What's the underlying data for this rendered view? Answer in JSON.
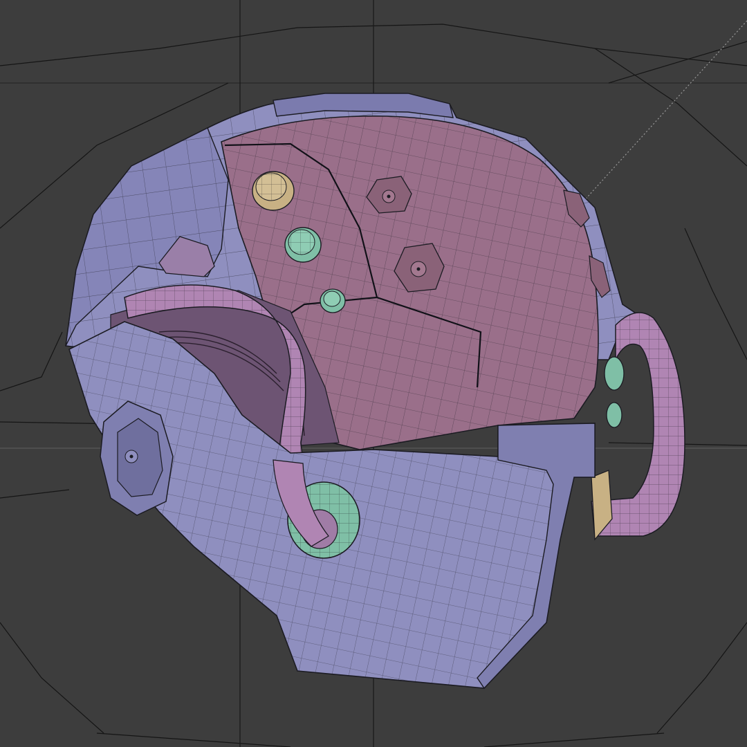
{
  "viewport": {
    "kind": "3d-viewport",
    "background_color": "#3d3d3d",
    "grid_color": "#151515",
    "axis_color": "#1a1a1a"
  },
  "model": {
    "name": "helmet",
    "shell_color": "#8f8fbf",
    "shell_dark_color": "#6f6f9e",
    "dome_color": "#9a6f8a",
    "hose_color": "#b085b3",
    "port_green_color": "#7fbfa6",
    "port_tan_color": "#c8b184",
    "wire_color": "#1b1b22"
  }
}
